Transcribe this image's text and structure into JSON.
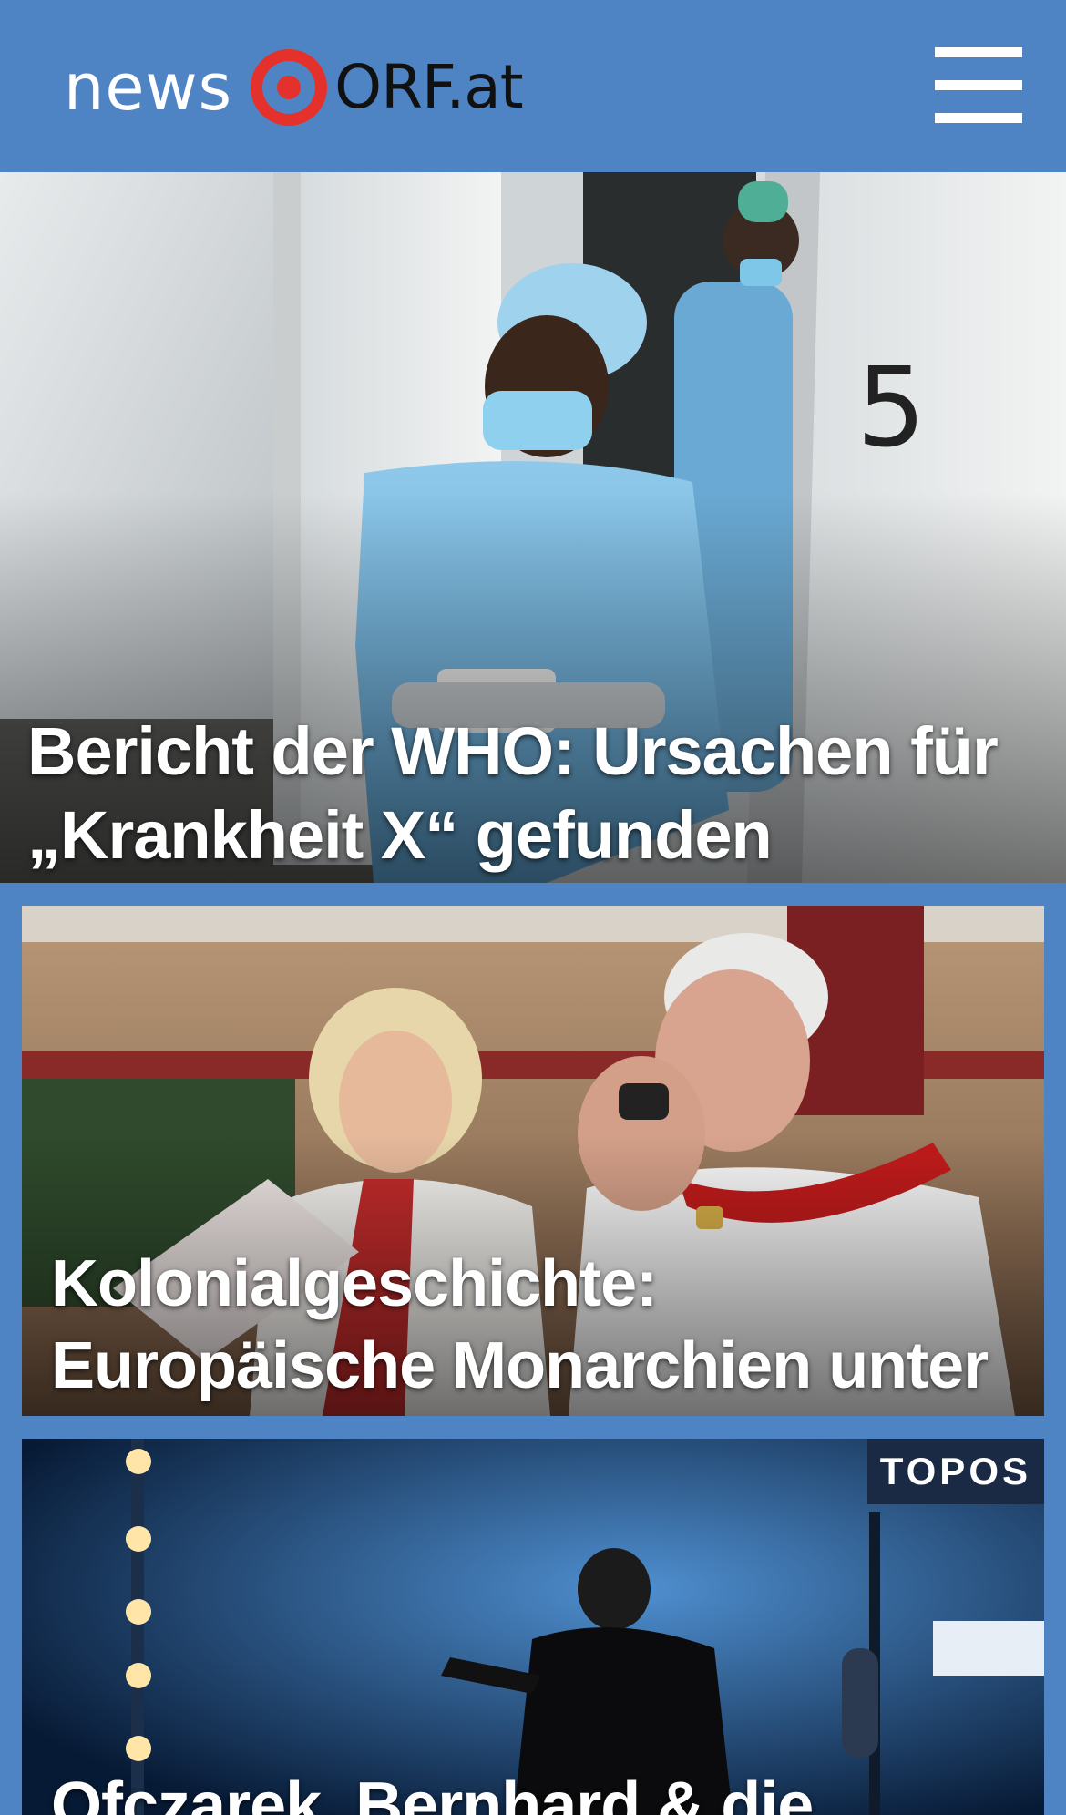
{
  "header": {
    "logo_news": "news",
    "logo_orf": "ORF.at",
    "menu_icon": "hamburger-menu-icon"
  },
  "stories": [
    {
      "title": "Bericht der WHO: Ursachen für „Krankheit X“ gefunden",
      "image": "healthcare-worker-in-protective-gear"
    },
    {
      "title": "Kolonialgeschichte: Europäische Monarchien unter Druck",
      "image": "king-and-queen-at-ceremony"
    },
    {
      "title": "Ofczarek, Bernhard & die",
      "badge": "TOPOS",
      "image": "stage-with-spotlights-and-musicians"
    }
  ],
  "colors": {
    "brand_blue": "#4f84c4",
    "logo_red": "#e4312b",
    "badge_bg": "#1a2a44"
  }
}
